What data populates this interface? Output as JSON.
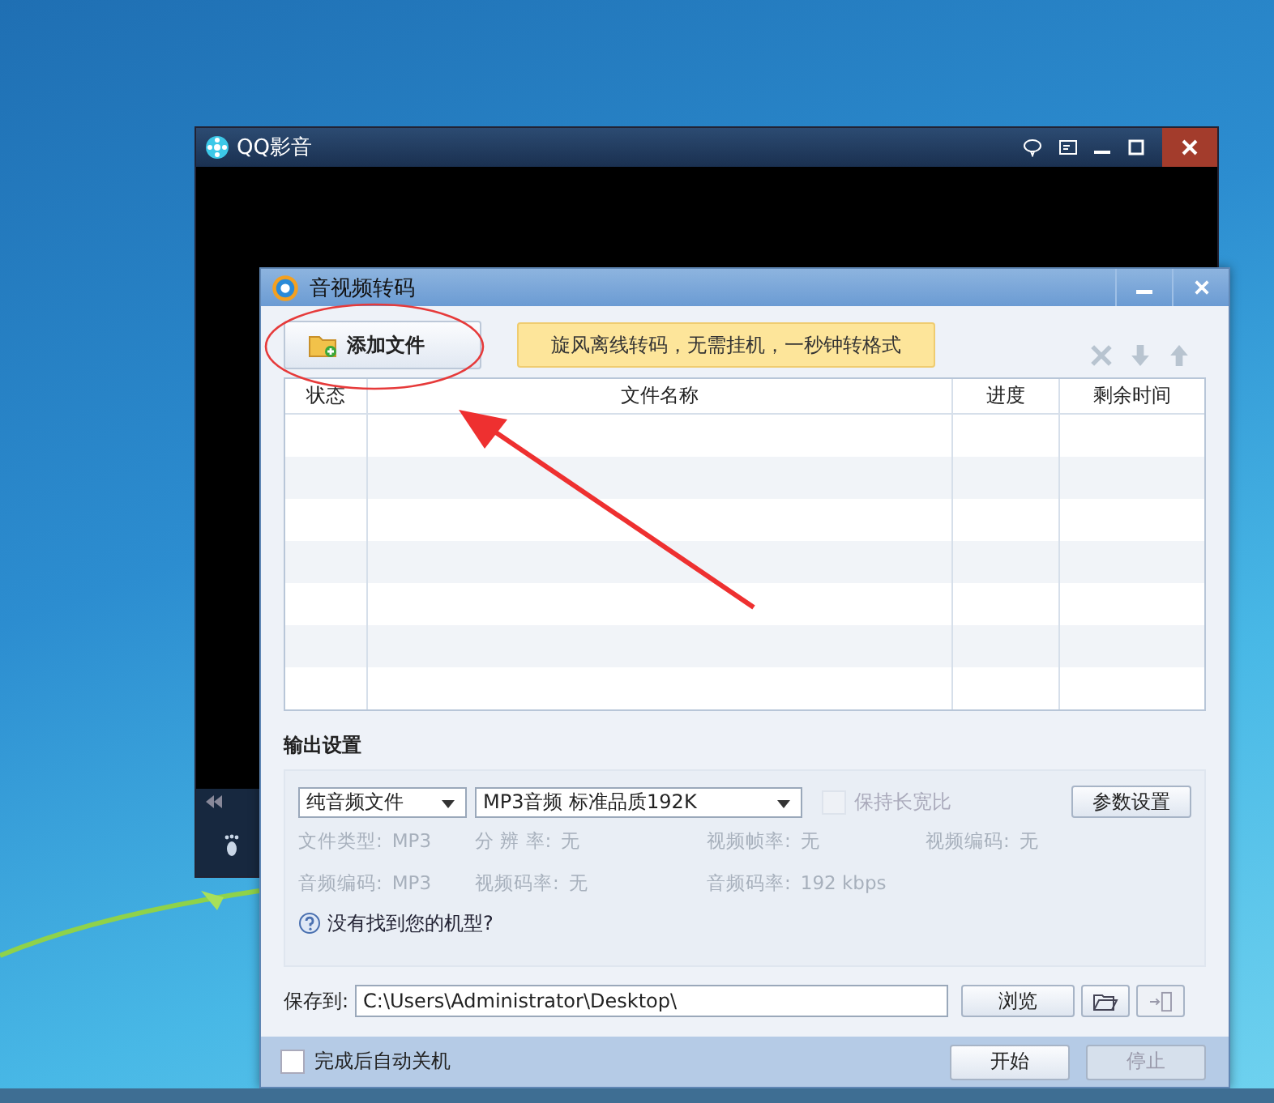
{
  "player": {
    "title": "QQ影音"
  },
  "dialog": {
    "title": "音视频转码",
    "add_button": "添加文件",
    "promo": "旋风离线转码，无需挂机，一秒钟转格式",
    "table": {
      "columns": [
        "状态",
        "文件名称",
        "进度",
        "剩余时间"
      ]
    },
    "output": {
      "heading": "输出设置",
      "format_select": "纯音频文件",
      "preset_select": "MP3音频 标准品质192K",
      "keep_ratio": {
        "label": "保持长宽比",
        "checked": false,
        "disabled": true
      },
      "params_button": "参数设置",
      "info": [
        [
          {
            "label": "文件类型:",
            "value": "MP3"
          },
          {
            "label": "分 辨 率:",
            "value": "无"
          },
          {
            "label": "视频帧率:",
            "value": "无"
          },
          {
            "label": "视频编码:",
            "value": "无"
          }
        ],
        [
          {
            "label": "音频编码:",
            "value": "MP3"
          },
          {
            "label": "视频码率:",
            "value": "无"
          },
          {
            "label": "音频码率:",
            "value": "192 kbps"
          }
        ]
      ],
      "help_link": "没有找到您的机型?"
    },
    "save": {
      "label": "保存到:",
      "path": "C:\\Users\\Administrator\\Desktop\\",
      "browse_button": "浏览"
    },
    "shutdown": {
      "label": "完成后自动关机",
      "checked": false
    },
    "buttons": [
      {
        "label": "开始",
        "disabled": false
      },
      {
        "label": "停止",
        "disabled": true
      }
    ]
  }
}
